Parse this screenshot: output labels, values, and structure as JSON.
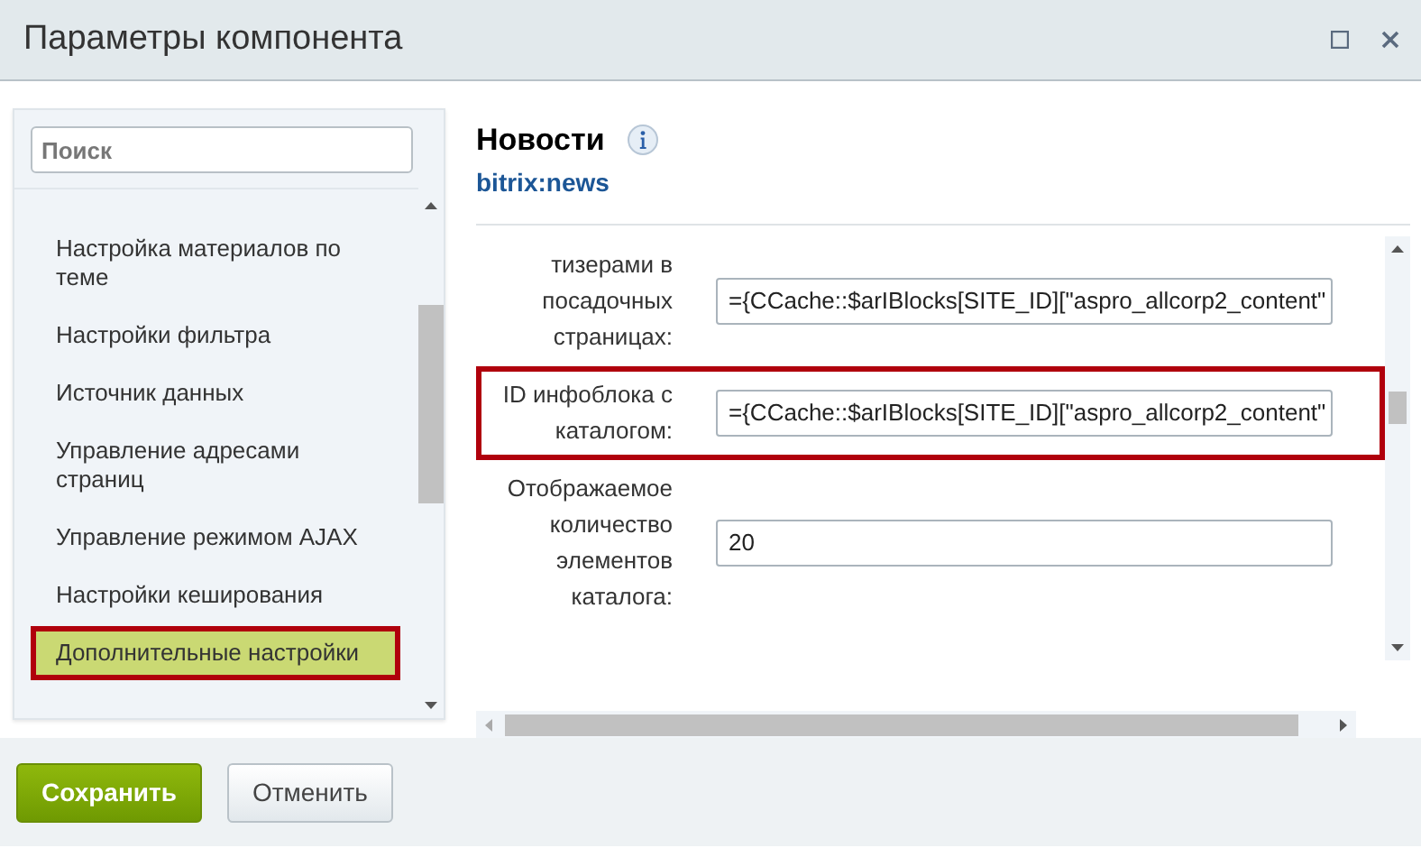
{
  "window": {
    "title": "Параметры компонента"
  },
  "sidebar": {
    "search": {
      "placeholder": "Поиск"
    },
    "items": [
      {
        "label": "Настройка материалов по теме",
        "selected": false,
        "highlighted": false
      },
      {
        "label": "Настройки фильтра",
        "selected": false,
        "highlighted": false
      },
      {
        "label": "Источник данных",
        "selected": false,
        "highlighted": false
      },
      {
        "label": "Управление адресами страниц",
        "selected": false,
        "highlighted": false
      },
      {
        "label": "Управление режимом AJAX",
        "selected": false,
        "highlighted": false
      },
      {
        "label": "Настройки кеширования",
        "selected": false,
        "highlighted": false
      },
      {
        "label": "Дополнительные настройки",
        "selected": true,
        "highlighted": true
      }
    ]
  },
  "component": {
    "title": "Новости",
    "code": "bitrix:news"
  },
  "params": [
    {
      "label": "тизерами в посадочных страницах:",
      "value": "={CCache::$arIBlocks[SITE_ID][\"aspro_allcorp2_content\"",
      "highlighted": false
    },
    {
      "label": "ID инфоблока с каталогом:",
      "value": "={CCache::$arIBlocks[SITE_ID][\"aspro_allcorp2_content\"",
      "highlighted": true
    },
    {
      "label": "Отображаемое количество элементов каталога:",
      "value": "20",
      "highlighted": false
    }
  ],
  "buttons": [
    {
      "label": "Сохранить",
      "kind": "primary"
    },
    {
      "label": "Отменить",
      "kind": "secondary"
    }
  ]
}
